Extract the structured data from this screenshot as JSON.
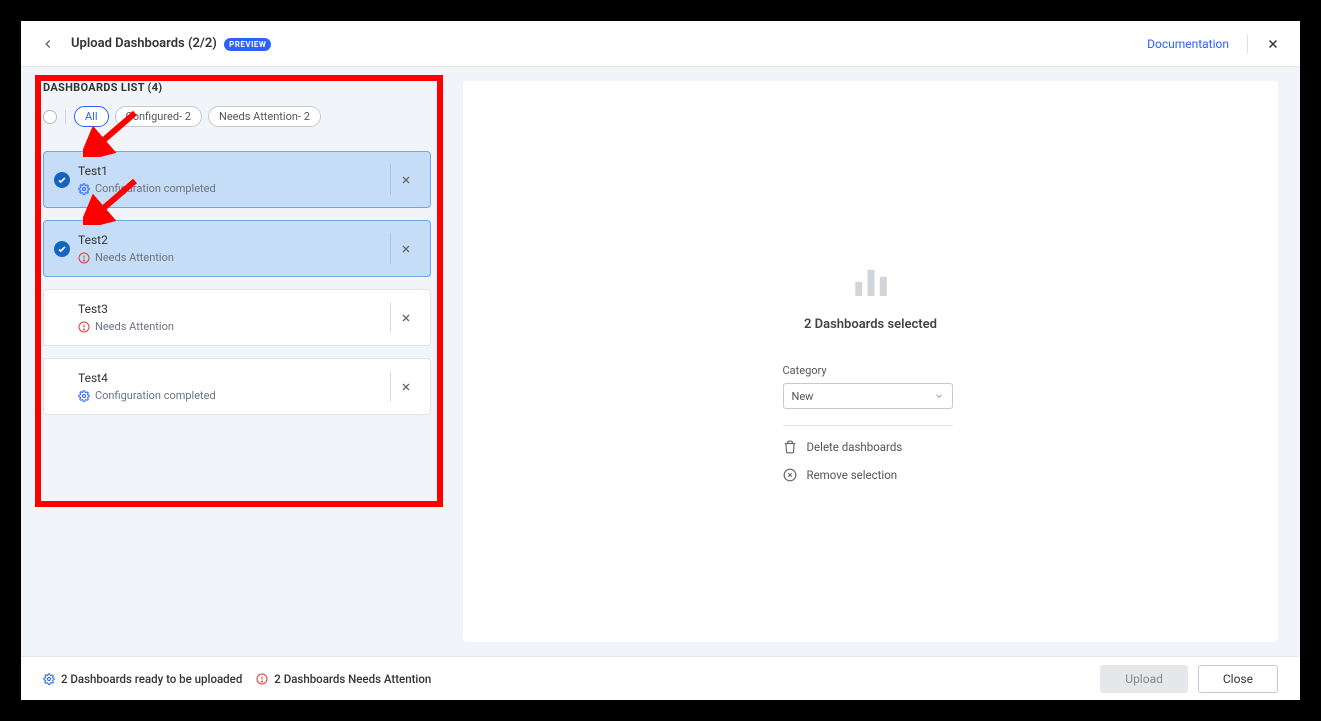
{
  "header": {
    "title": "Upload Dashboards (2/2)",
    "preview_badge": "PREVIEW",
    "documentation": "Documentation"
  },
  "list": {
    "title": "DASHBOARDS LIST (4)",
    "filters": {
      "all": "All",
      "configured": "Configured- 2",
      "attention": "Needs Attention- 2"
    },
    "items": [
      {
        "name": "Test1",
        "status_text": "Configuration completed",
        "status": "ok",
        "selected": true
      },
      {
        "name": "Test2",
        "status_text": "Needs Attention",
        "status": "warn",
        "selected": true
      },
      {
        "name": "Test3",
        "status_text": "Needs Attention",
        "status": "warn",
        "selected": false
      },
      {
        "name": "Test4",
        "status_text": "Configuration completed",
        "status": "ok",
        "selected": false
      }
    ]
  },
  "right": {
    "selected_title": "2 Dashboards selected",
    "category_label": "Category",
    "category_value": "New",
    "delete": "Delete dashboards",
    "remove": "Remove selection"
  },
  "footer": {
    "ready": "2 Dashboards ready to be uploaded",
    "attention": "2 Dashboards Needs Attention",
    "upload": "Upload",
    "close": "Close"
  }
}
